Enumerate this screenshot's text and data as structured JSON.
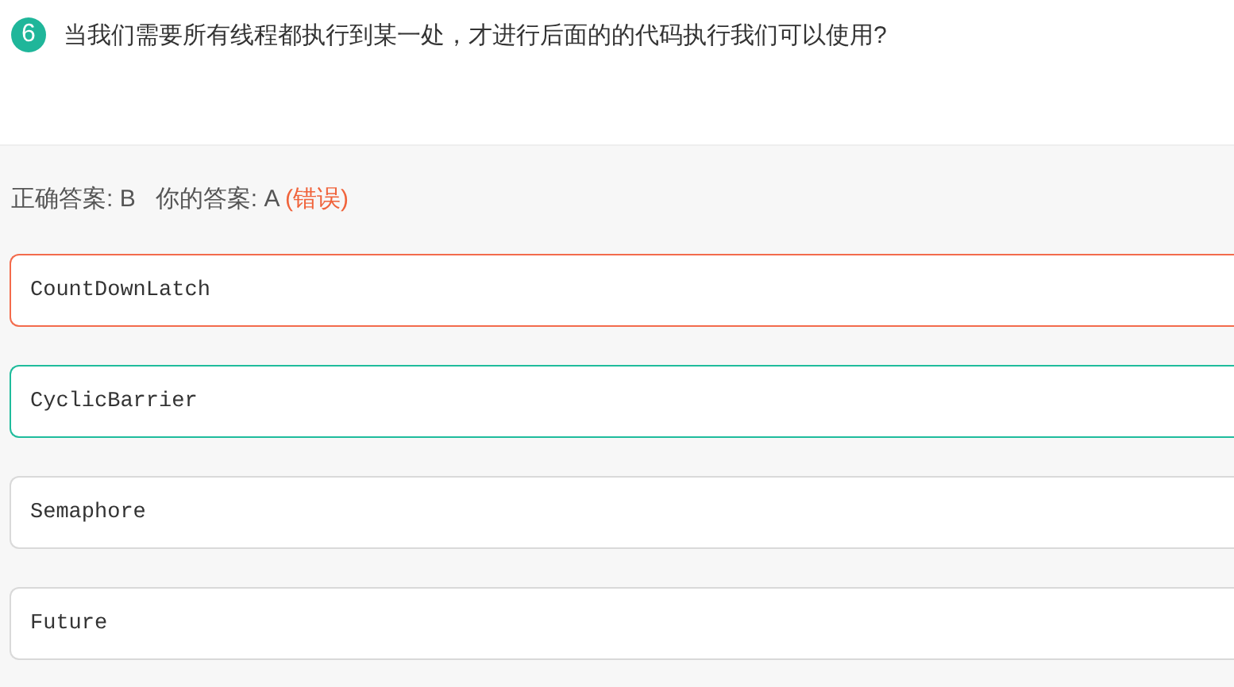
{
  "question": {
    "number": "6",
    "text": "当我们需要所有线程都执行到某一处，才进行后面的的代码执行我们可以使用?"
  },
  "result": {
    "correct_answer": "正确答案: B",
    "your_answer": "你的答案: A",
    "verdict": "(错误)"
  },
  "options": [
    {
      "text": "CountDownLatch",
      "selected": true,
      "correct": false
    },
    {
      "text": "CyclicBarrier",
      "selected": false,
      "correct": true
    },
    {
      "text": "Semaphore",
      "selected": false,
      "correct": false
    },
    {
      "text": "Future",
      "selected": false,
      "correct": false
    }
  ]
}
